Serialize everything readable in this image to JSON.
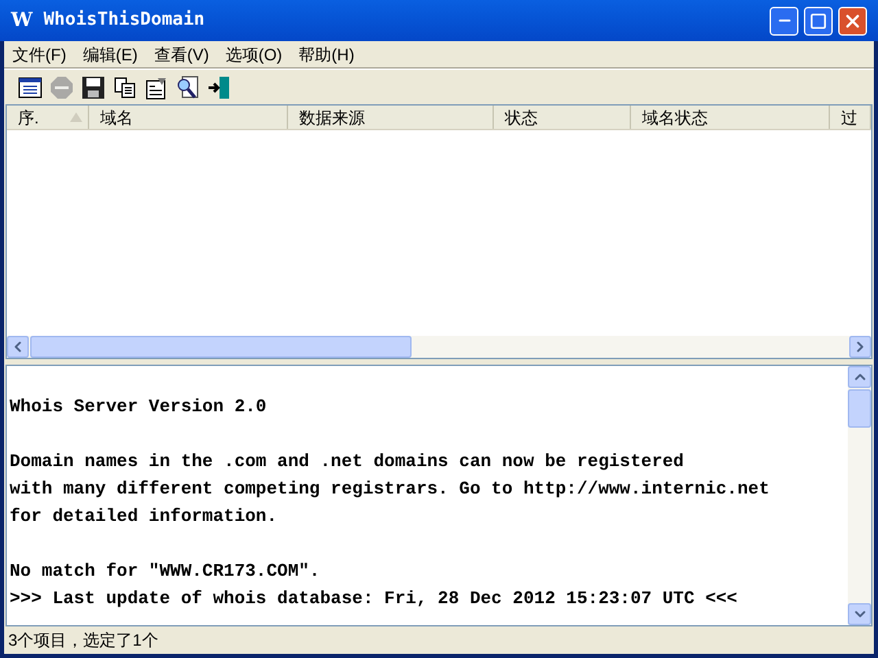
{
  "window": {
    "title": "WhoisThisDomain",
    "logo": "W"
  },
  "menu": [
    {
      "label": "文件(F)"
    },
    {
      "label": "编辑(E)"
    },
    {
      "label": "查看(V)"
    },
    {
      "label": "选项(O)"
    },
    {
      "label": "帮助(H)"
    }
  ],
  "toolbar": [
    {
      "kind": "list",
      "disabled": false
    },
    {
      "kind": "stop",
      "disabled": true
    },
    {
      "kind": "save",
      "disabled": false
    },
    {
      "kind": "copy",
      "disabled": false
    },
    {
      "kind": "properties",
      "disabled": false
    },
    {
      "kind": "find",
      "disabled": false
    },
    {
      "kind": "exit",
      "disabled": false
    }
  ],
  "table": {
    "columns": [
      {
        "label": "序.",
        "sorted": true
      },
      {
        "label": "域名",
        "sorted": false
      },
      {
        "label": "数据来源",
        "sorted": false
      },
      {
        "label": "状态",
        "sorted": false
      },
      {
        "label": "域名状态",
        "sorted": false
      },
      {
        "label": "过",
        "sorted": false
      }
    ]
  },
  "output": {
    "paragraphs": [
      [
        "Whois Server Version 2.0"
      ],
      [
        "Domain names in the .com and .net domains can now be registered",
        "with many different competing registrars. Go to http://www.internic.net",
        "for detailed information."
      ],
      [
        "No match for \"WWW.CR173.COM\".",
        ">>> Last update of whois database: Fri, 28 Dec 2012 15:23:07 UTC <<<"
      ]
    ]
  },
  "status_bar": "3个项目，选定了1个"
}
